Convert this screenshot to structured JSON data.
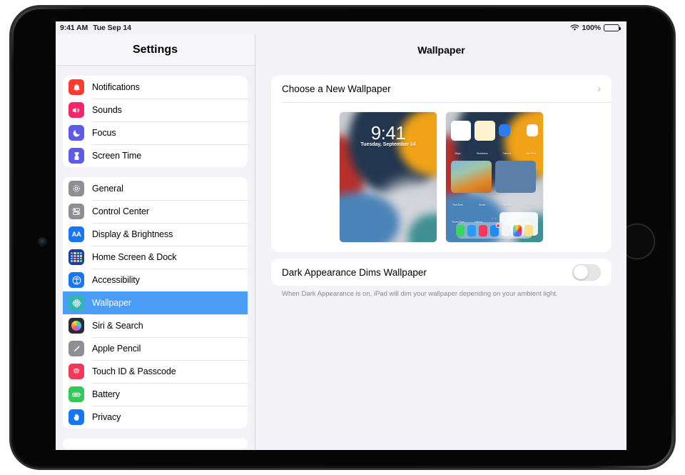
{
  "status_bar": {
    "time": "9:41 AM",
    "date": "Tue Sep 14",
    "wifi_icon": "wifi-icon",
    "battery_percent": "100%",
    "battery_icon": "battery-full-icon"
  },
  "sidebar": {
    "title": "Settings",
    "groups": [
      {
        "items": [
          {
            "label": "Notifications",
            "icon": "bell-icon",
            "color": "#ff3b30",
            "selected": false
          },
          {
            "label": "Sounds",
            "icon": "speaker-icon",
            "color": "#f2286a",
            "selected": false
          },
          {
            "label": "Focus",
            "icon": "moon-icon",
            "color": "#5e5ce6",
            "selected": false
          },
          {
            "label": "Screen Time",
            "icon": "hourglass-icon",
            "color": "#5e5ce6",
            "selected": false
          }
        ]
      },
      {
        "items": [
          {
            "label": "General",
            "icon": "gear-icon",
            "color": "#8e8e93",
            "selected": false
          },
          {
            "label": "Control Center",
            "icon": "sliders-icon",
            "color": "#8e8e93",
            "selected": false
          },
          {
            "label": "Display & Brightness",
            "icon": "text-size-icon",
            "color": "#1676f3",
            "selected": false
          },
          {
            "label": "Home Screen & Dock",
            "icon": "app-grid-icon",
            "color": "#1b3fa0",
            "selected": false
          },
          {
            "label": "Accessibility",
            "icon": "accessibility-icon",
            "color": "#1676f3",
            "selected": false
          },
          {
            "label": "Wallpaper",
            "icon": "flower-icon",
            "color": "#31b5b0",
            "selected": true
          },
          {
            "label": "Siri & Search",
            "icon": "siri-icon",
            "color": "#2b2b35",
            "selected": false
          },
          {
            "label": "Apple Pencil",
            "icon": "pencil-icon",
            "color": "#8e8e93",
            "selected": false
          },
          {
            "label": "Touch ID & Passcode",
            "icon": "fingerprint-icon",
            "color": "#f2395a",
            "selected": false
          },
          {
            "label": "Battery",
            "icon": "battery-icon",
            "color": "#34c759",
            "selected": false
          },
          {
            "label": "Privacy",
            "icon": "hand-raised-icon",
            "color": "#1676f3",
            "selected": false
          }
        ]
      }
    ],
    "selected_color": "#4a9cf5"
  },
  "detail": {
    "title": "Wallpaper",
    "choose_row": {
      "label": "Choose a New Wallpaper",
      "chevron_icon": "chevron-right-icon"
    },
    "previews": {
      "lock_screen": {
        "name": "lock-screen-preview",
        "time": "9:41",
        "date": "Tuesday, September 14"
      },
      "home_screen": {
        "name": "home-screen-preview",
        "apps": [
          {
            "label": "Maps",
            "color": "#eef3f7"
          },
          {
            "label": "Reminders",
            "color": "#fbfbfd"
          },
          {
            "label": "Camera",
            "color": "#4a4a4f"
          },
          {
            "label": "App Store",
            "color": "#1d8bf7"
          }
        ],
        "apps_row2": [
          {
            "label": "FaceTime",
            "color": "#32d04e"
          },
          {
            "label": "Books",
            "color": "#fb8c14"
          },
          {
            "label": "Podcasts",
            "color": "#9b3bd1"
          },
          {
            "label": "TV",
            "color": "#111114"
          }
        ],
        "apps_row3": [
          {
            "label": "iTunes Store",
            "color": "#16161a"
          },
          {
            "label": "Settings",
            "color": "#9a9aa0"
          }
        ],
        "widgets": [
          {
            "label": "Calendar",
            "color": "#ffffff"
          },
          {
            "label": "Notes",
            "color": "#fdf3d0"
          },
          {
            "label": "Files",
            "color": "#2b7cf0"
          },
          {
            "label": "Reminders",
            "color": "#ffffff"
          }
        ],
        "dock": [
          {
            "label": "Messages",
            "color": "#3ad55e",
            "badge": false
          },
          {
            "label": "Safari",
            "color": "#2b9bf4",
            "badge": false
          },
          {
            "label": "Music",
            "color": "#f9365c",
            "badge": false
          },
          {
            "label": "Mail",
            "color": "#1f8bf5",
            "badge": true
          },
          {
            "label": "Calendar",
            "color": "#f4f4f6",
            "badge": false
          },
          {
            "label": "Photos",
            "color": "#fbfbfd",
            "badge": false
          },
          {
            "label": "Notes",
            "color": "#fbe08a",
            "badge": false
          }
        ],
        "page_dots": "• •"
      }
    },
    "dark_appearance_row": {
      "label": "Dark Appearance Dims Wallpaper",
      "toggle_state": "off"
    },
    "footnote": "When Dark Appearance is on, iPad will dim your wallpaper depending on your ambient light."
  }
}
